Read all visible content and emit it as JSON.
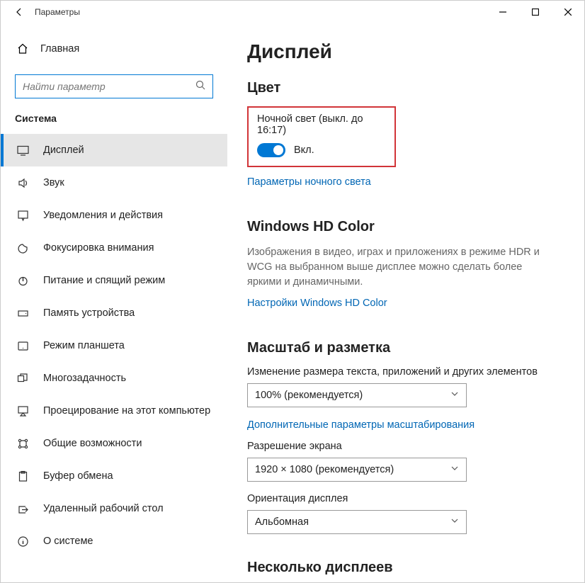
{
  "titlebar": {
    "title": "Параметры"
  },
  "sidebar": {
    "home": "Главная",
    "search_placeholder": "Найти параметр",
    "section": "Система",
    "items": [
      {
        "label": "Дисплей"
      },
      {
        "label": "Звук"
      },
      {
        "label": "Уведомления и действия"
      },
      {
        "label": "Фокусировка внимания"
      },
      {
        "label": "Питание и спящий режим"
      },
      {
        "label": "Память устройства"
      },
      {
        "label": "Режим планшета"
      },
      {
        "label": "Многозадачность"
      },
      {
        "label": "Проецирование на этот компьютер"
      },
      {
        "label": "Общие возможности"
      },
      {
        "label": "Буфер обмена"
      },
      {
        "label": "Удаленный рабочий стол"
      },
      {
        "label": "О системе"
      }
    ]
  },
  "content": {
    "page_title": "Дисплей",
    "color": {
      "heading": "Цвет",
      "night_light_label": "Ночной свет (выкл. до 16:17)",
      "toggle_state": "Вкл.",
      "settings_link": "Параметры ночного света"
    },
    "hdcolor": {
      "heading": "Windows HD Color",
      "description": "Изображения в видео, играх и приложениях в режиме HDR и WCG на выбранном выше дисплее можно сделать более яркими и динамичными.",
      "link": "Настройки Windows HD Color"
    },
    "scale": {
      "heading": "Масштаб и разметка",
      "size_label": "Изменение размера текста, приложений и других элементов",
      "size_value": "100% (рекомендуется)",
      "advanced_link": "Дополнительные параметры масштабирования",
      "resolution_label": "Разрешение экрана",
      "resolution_value": "1920 × 1080 (рекомендуется)",
      "orientation_label": "Ориентация дисплея",
      "orientation_value": "Альбомная"
    },
    "multi": {
      "heading": "Несколько дисплеев"
    }
  }
}
